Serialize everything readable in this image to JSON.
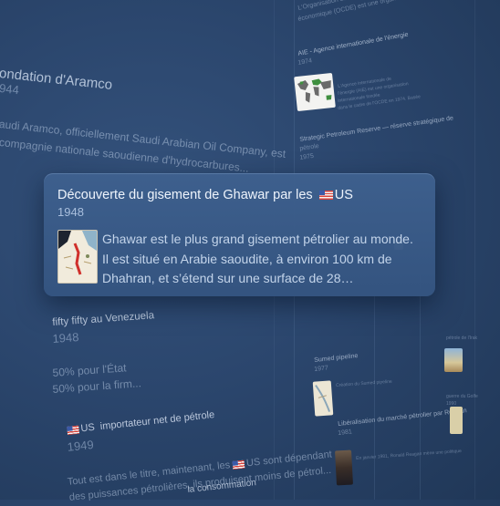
{
  "featured": {
    "title_prefix": "Découverte du gisement de Ghawar par les",
    "title_country": "US",
    "year": "1948",
    "excerpt": "Ghawar est le plus grand gisement pétrolier au monde. Il est situé en Arabie saoudite, à environ 100 km de Dhahran, et s’étend sur une surface de 28…"
  },
  "background": {
    "aramco": {
      "title": "ondation d'Aramco",
      "year": "944",
      "line1": "audi Aramco, officiellement Saudi Arabian Oil Company, est",
      "line2": "compagnie nationale saoudienne d'hydrocarbures..."
    },
    "venezuela": {
      "title": "fifty fifty au Venezuela",
      "year": "1948",
      "line1": "50% pour l'État",
      "line2": "50% pour la firm..."
    },
    "importer": {
      "title_country": "US",
      "title_rest": "importateur net de pétrole",
      "year": "1949",
      "line1_a": "Tout est dans le titre, maintenant, les",
      "line1_country": "US",
      "line1_b": "sont dépendant",
      "line2": "des puissances pétrolières, ils produisent moins de pétrol..."
    },
    "bottom_fragment": "la consommation",
    "aie": {
      "title": "AIE - Agence internationale de l'énergie",
      "year": "1974",
      "desc1": "L'Agence internationale de",
      "desc2": "l'énergie (AIE) est une organisation",
      "desc3": "internationale fondée",
      "desc4": "dans le cadre de l'OCDE en 1974. Basée"
    },
    "top_fragment1": "L'Organisation de la coopération et de développement",
    "top_fragment2": "économique (OCDE) est une organisation internationale",
    "spr": {
      "title1": "Strategic Petroleum Reserve",
      "title2": "réserve stratégique de",
      "title3": "pétrole",
      "year": "1975"
    },
    "sumed": {
      "title": "Sumed pipeline",
      "year": "1977",
      "desc": "Création du Sumed pipeline"
    },
    "liberalisation": {
      "title": "Libéralisation du marché pétrolier par Reagan",
      "year": "1981",
      "desc": "En janvier 1981, Ronald Reagan mène une politique"
    },
    "right_fragments": [
      "pétrole de l'Irak",
      "guerre du Golfe",
      "1990"
    ]
  }
}
